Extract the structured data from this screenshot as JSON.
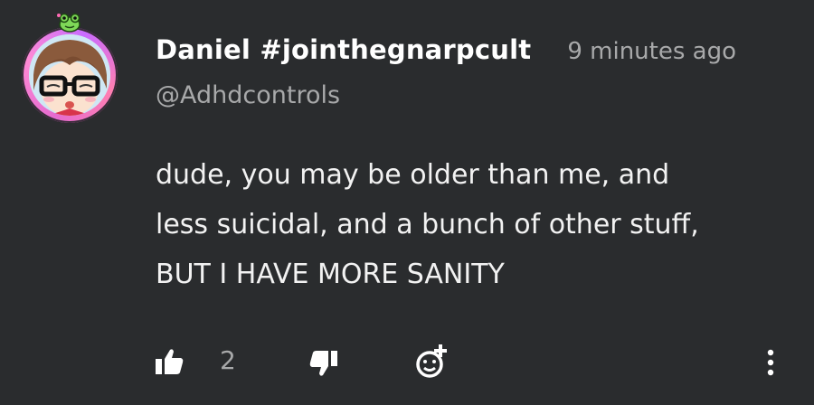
{
  "comment": {
    "author_name": "Daniel #jointhegnarpcult",
    "timestamp": "9 minutes ago",
    "handle": "@Adhdcontrols",
    "body_lines": [
      "dude, you may be older than me, and",
      "less suicidal, and a bunch of other stuff,",
      "BUT I HAVE MORE SANITY"
    ],
    "like_count": "2"
  },
  "icons": {
    "like": "thumbs-up-icon",
    "dislike": "thumbs-down-icon",
    "reaction": "add-emoji-icon",
    "more": "more-vertical-icon"
  },
  "colors": {
    "background": "#2a2c2e",
    "primary_text": "#ffffff",
    "secondary_text": "#a8a9aa",
    "avatar_ring": "#e56bd0"
  }
}
